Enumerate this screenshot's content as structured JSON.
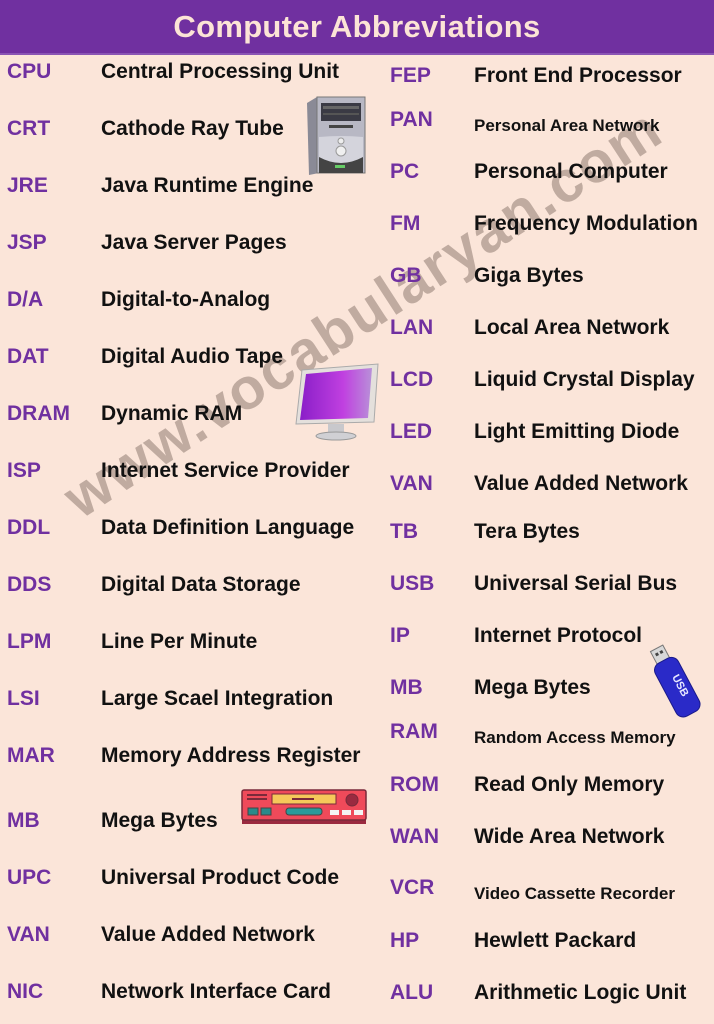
{
  "title": "Computer Abbreviations",
  "watermark": "www.vocabularyan.com",
  "colors": {
    "header_bg": "#7030a0",
    "title_text": "#fce4d6",
    "page_bg": "#fbe5d9",
    "abbr_text": "#7030a0",
    "full_text": "#111111"
  },
  "left_column": [
    {
      "abbr": "CPU",
      "full": "Central Processing Unit"
    },
    {
      "abbr": "CRT",
      "full": "Cathode Ray Tube"
    },
    {
      "abbr": "JRE",
      "full": "Java Runtime Engine"
    },
    {
      "abbr": "JSP",
      "full": "Java Server Pages"
    },
    {
      "abbr": "D/A",
      "full": "Digital-to-Analog"
    },
    {
      "abbr": "DAT",
      "full": "Digital Audio Tape"
    },
    {
      "abbr": "DRAM",
      "full": "Dynamic RAM"
    },
    {
      "abbr": "ISP",
      "full": "Internet Service Provider"
    },
    {
      "abbr": "DDL",
      "full": "Data Definition Language"
    },
    {
      "abbr": "DDS",
      "full": "Digital Data Storage"
    },
    {
      "abbr": "LPM",
      "full": "Line Per Minute"
    },
    {
      "abbr": "LSI",
      "full": "Large Scael Integration"
    },
    {
      "abbr": "MAR",
      "full": "Memory Address Register"
    },
    {
      "abbr": "MB",
      "full": "Mega Bytes"
    },
    {
      "abbr": "UPC",
      "full": "Universal Product Code"
    },
    {
      "abbr": "VAN",
      "full": "Value Added Network"
    },
    {
      "abbr": "NIC",
      "full": "Network Interface Card"
    }
  ],
  "right_column": [
    {
      "abbr": "FEP",
      "full": "Front End Processor"
    },
    {
      "abbr": "PAN",
      "full": "Personal Area Network"
    },
    {
      "abbr": "PC",
      "full": "Personal Computer"
    },
    {
      "abbr": "FM",
      "full": "Frequency Modulation"
    },
    {
      "abbr": "GB",
      "full": "Giga Bytes"
    },
    {
      "abbr": "LAN",
      "full": "Local Area Network"
    },
    {
      "abbr": "LCD",
      "full": "Liquid Crystal Display"
    },
    {
      "abbr": "LED",
      "full": "Light Emitting Diode"
    },
    {
      "abbr": "VAN",
      "full": "Value Added Network"
    },
    {
      "abbr": "TB",
      "full": "Tera Bytes"
    },
    {
      "abbr": "USB",
      "full": "Universal Serial Bus"
    },
    {
      "abbr": "IP",
      "full": "Internet Protocol"
    },
    {
      "abbr": "MB",
      "full": "Mega Bytes"
    },
    {
      "abbr": "RAM",
      "full": "Random Access Memory"
    },
    {
      "abbr": "ROM",
      "full": "Read Only Memory"
    },
    {
      "abbr": "WAN",
      "full": "Wide Area Network"
    },
    {
      "abbr": "VCR",
      "full": "Video Cassette Recorder"
    },
    {
      "abbr": "HP",
      "full": "Hewlett Packard"
    },
    {
      "abbr": "ALU",
      "full": "Arithmetic Logic Unit"
    }
  ],
  "clipart": {
    "usb_label": "USB"
  }
}
